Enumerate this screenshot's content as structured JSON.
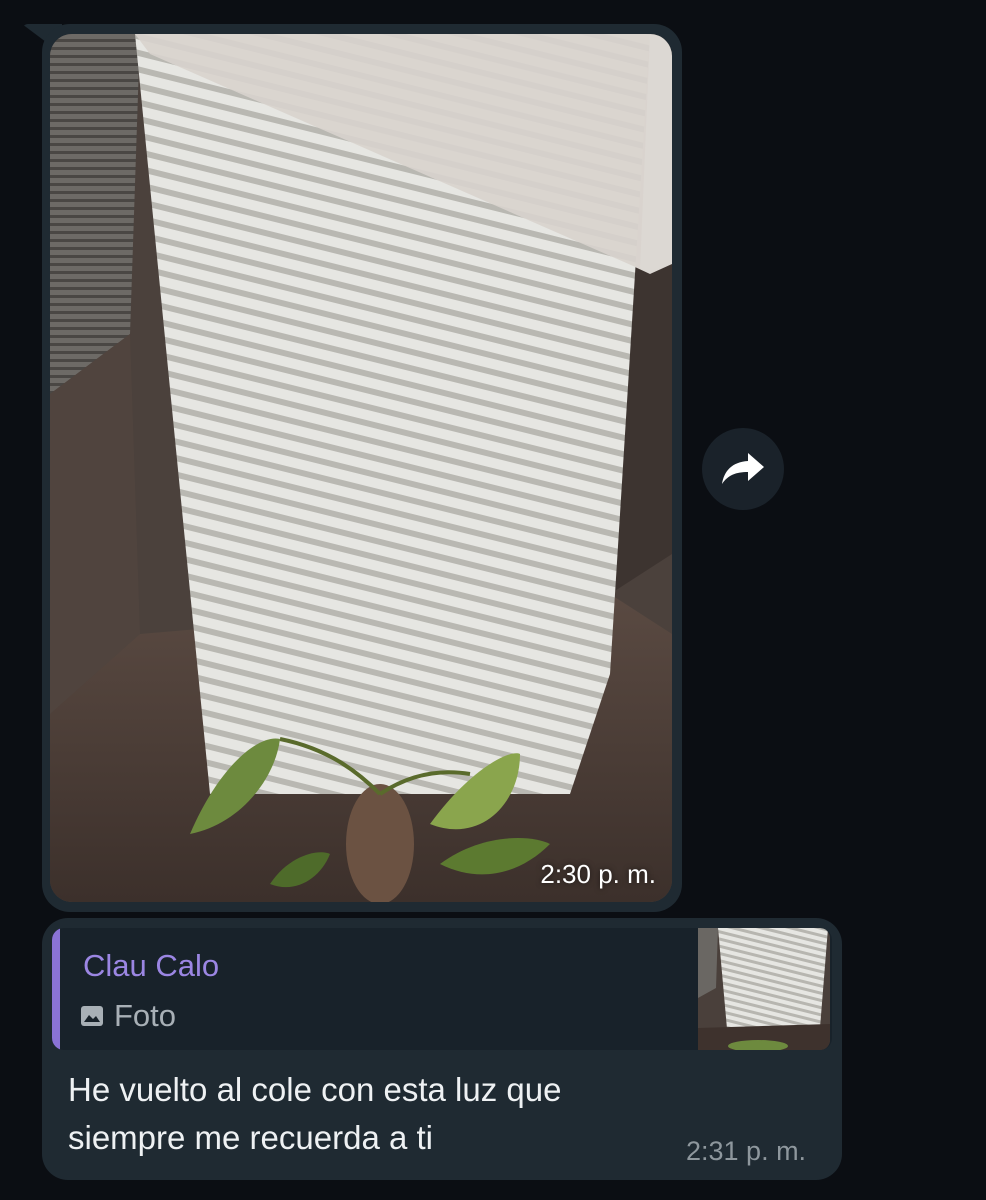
{
  "messages": [
    {
      "type": "photo",
      "time": "2:30 p. m."
    },
    {
      "type": "reply",
      "reply_to": {
        "author": "Clau Calo",
        "media_label": "Foto",
        "media_icon": "image-icon"
      },
      "text": "He vuelto al cole con esta luz que\nsiempre me recuerda a ti",
      "time": "2:31 p. m."
    }
  ],
  "actions": {
    "forward_icon": "forward-arrow-icon"
  },
  "colors": {
    "background": "#0b0e13",
    "bubble": "#1f2a32",
    "quote_accent": "#8a73d6",
    "author_name": "#9b86e3"
  }
}
